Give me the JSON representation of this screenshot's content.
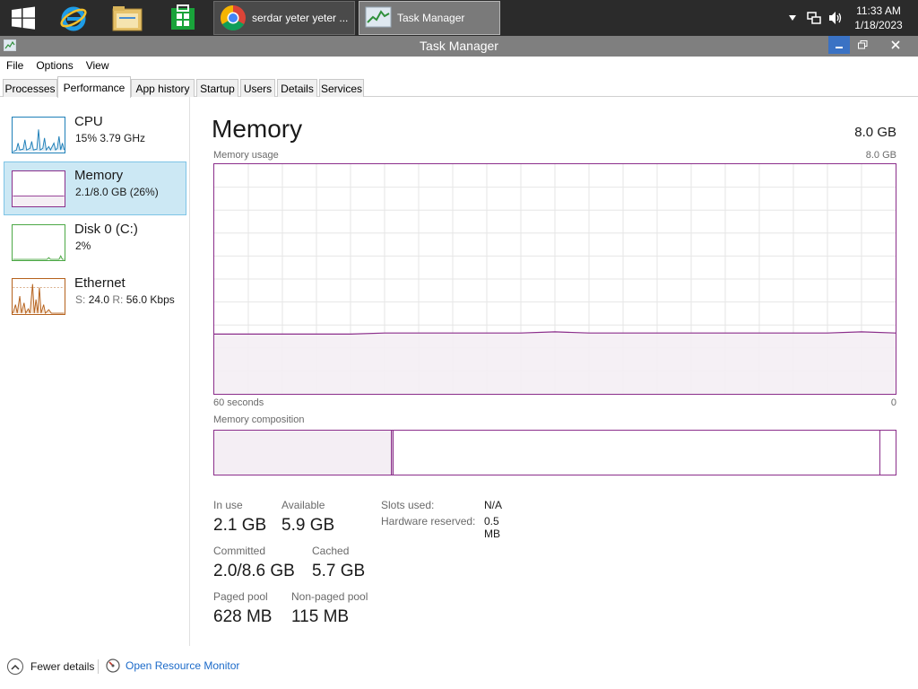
{
  "taskbar": {
    "tasks": [
      {
        "label": "serdar yeter yeter ..."
      },
      {
        "label": "Task Manager"
      }
    ],
    "clock": {
      "time": "11:33 AM",
      "date": "1/18/2023"
    }
  },
  "window": {
    "title": "Task Manager"
  },
  "menu": {
    "file": "File",
    "options": "Options",
    "view": "View"
  },
  "tabs": [
    {
      "label": "Processes"
    },
    {
      "label": "Performance"
    },
    {
      "label": "App history"
    },
    {
      "label": "Startup"
    },
    {
      "label": "Users"
    },
    {
      "label": "Details"
    },
    {
      "label": "Services"
    }
  ],
  "sidebar": {
    "items": [
      {
        "name": "CPU",
        "detail": "15%  3.79 GHz"
      },
      {
        "name": "Memory",
        "detail": "2.1/8.0 GB (26%)"
      },
      {
        "name": "Disk 0 (C:)",
        "detail": "2%"
      },
      {
        "name": "Ethernet",
        "detail_s_label": "S:",
        "detail_s_value": "24.0",
        "detail_r_label": "R:",
        "detail_r_value": "56.0 Kbps"
      }
    ]
  },
  "memory": {
    "title": "Memory",
    "total": "8.0 GB",
    "usage_label": "Memory usage",
    "usage_max": "8.0 GB",
    "time_span": "60 seconds",
    "time_end": "0",
    "composition_label": "Memory composition",
    "usage_history_fraction": [
      0.26,
      0.26,
      0.26,
      0.26,
      0.26,
      0.265,
      0.265,
      0.265,
      0.265,
      0.265,
      0.27,
      0.265,
      0.265,
      0.265,
      0.265,
      0.265,
      0.265,
      0.265,
      0.265,
      0.27,
      0.265
    ],
    "composition_fractions": {
      "in_use": 0.26,
      "modified": 0.002,
      "standby": 0.715,
      "free": 0.023
    },
    "colors": {
      "accent": "#8b2e8b",
      "fill": "#f4eef4",
      "grid": "#e6e6e6"
    },
    "stats": {
      "in_use_label": "In use",
      "in_use": "2.1 GB",
      "available_label": "Available",
      "available": "5.9 GB",
      "committed_label": "Committed",
      "committed": "2.0/8.6 GB",
      "cached_label": "Cached",
      "cached": "5.7 GB",
      "paged_pool_label": "Paged pool",
      "paged_pool": "628 MB",
      "nonpaged_pool_label": "Non-paged pool",
      "nonpaged_pool": "115 MB",
      "slots_used_label": "Slots used:",
      "slots_used": "N/A",
      "hw_reserved_label": "Hardware reserved:",
      "hw_reserved": "0.5 MB"
    }
  },
  "footer": {
    "fewer_details": "Fewer details",
    "open_resource_monitor": "Open Resource Monitor"
  }
}
